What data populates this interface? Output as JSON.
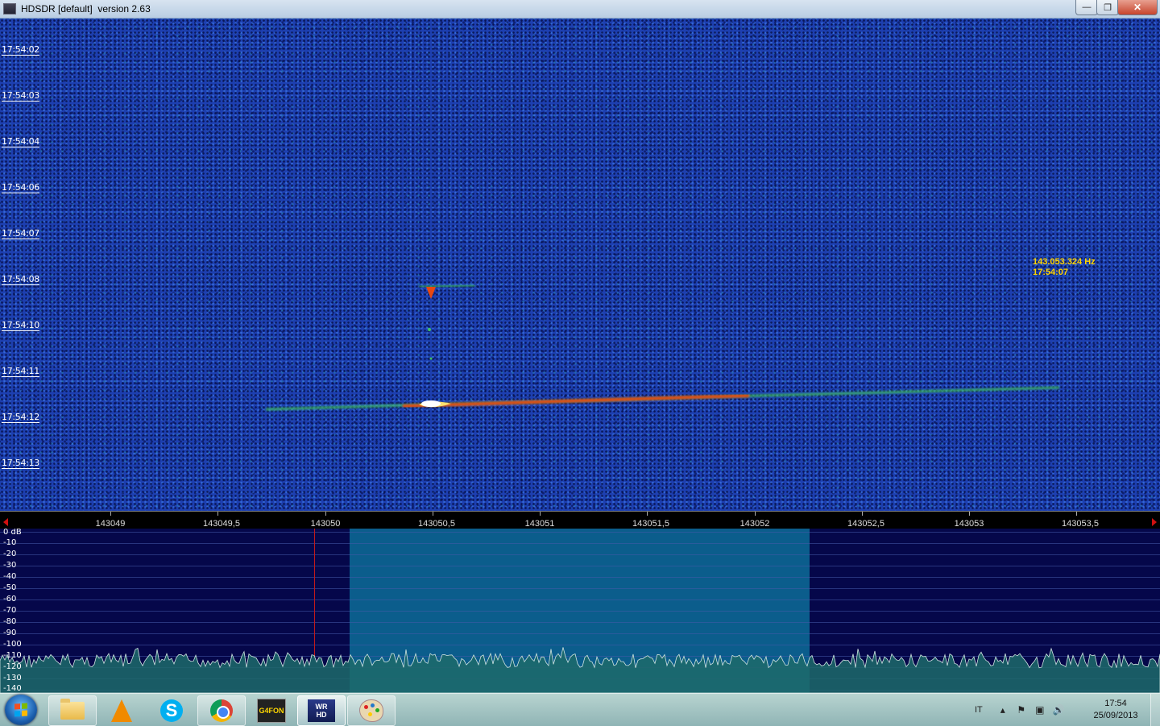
{
  "window": {
    "title": "HDSDR [default]  version 2.63",
    "minimize_icon": "minimize-icon",
    "restore_icon": "restore-icon",
    "close_icon": "close-icon"
  },
  "waterfall": {
    "time_labels": [
      "17:54:02",
      "17:54:03",
      "17:54:04",
      "17:54:06",
      "17:54:07",
      "17:54:08",
      "17:54:10",
      "17:54:11",
      "17:54:12",
      "17:54:13"
    ],
    "cursor_readout": {
      "frequency": "143.053.324 Hz",
      "time": "17:54:07"
    },
    "colors": {
      "background": "#1d3fb0",
      "signal_strong": "#ffffff",
      "signal_mid": "#e03a10",
      "signal_weak": "#40c060"
    }
  },
  "frequency_axis": {
    "labels": [
      "143049",
      "143049,5",
      "143050",
      "143050,5",
      "143051",
      "143051,5",
      "143052",
      "143052,5",
      "143053",
      "143053,5"
    ]
  },
  "spectrum": {
    "db_labels": [
      "0 dB",
      "-10",
      "-20",
      "-30",
      "-40",
      "-50",
      "-60",
      "-70",
      "-80",
      "-90",
      "-100",
      "-110",
      "-120",
      "-130",
      "-140"
    ],
    "colors": {
      "background": "#05074a",
      "passband": "#0b5d8c",
      "tune_marker": "#c01a1a"
    }
  },
  "taskbar": {
    "start_icon": "windows-start-icon",
    "apps": [
      {
        "name": "explorer",
        "icon": "folder-icon"
      },
      {
        "name": "vlc",
        "icon": "vlc-icon"
      },
      {
        "name": "skype",
        "icon": "skype-icon"
      },
      {
        "name": "chrome",
        "icon": "chrome-icon"
      },
      {
        "name": "g4fon",
        "icon": "g4fon-icon",
        "badge": "G4FON"
      },
      {
        "name": "wrhd",
        "icon": "wr-hd-icon",
        "badge_top": "WR",
        "badge_bottom": "HD"
      },
      {
        "name": "paint",
        "icon": "paint-icon"
      }
    ],
    "tray": {
      "language": "IT",
      "clock_time": "17:54",
      "clock_date": "25/09/2013"
    }
  }
}
